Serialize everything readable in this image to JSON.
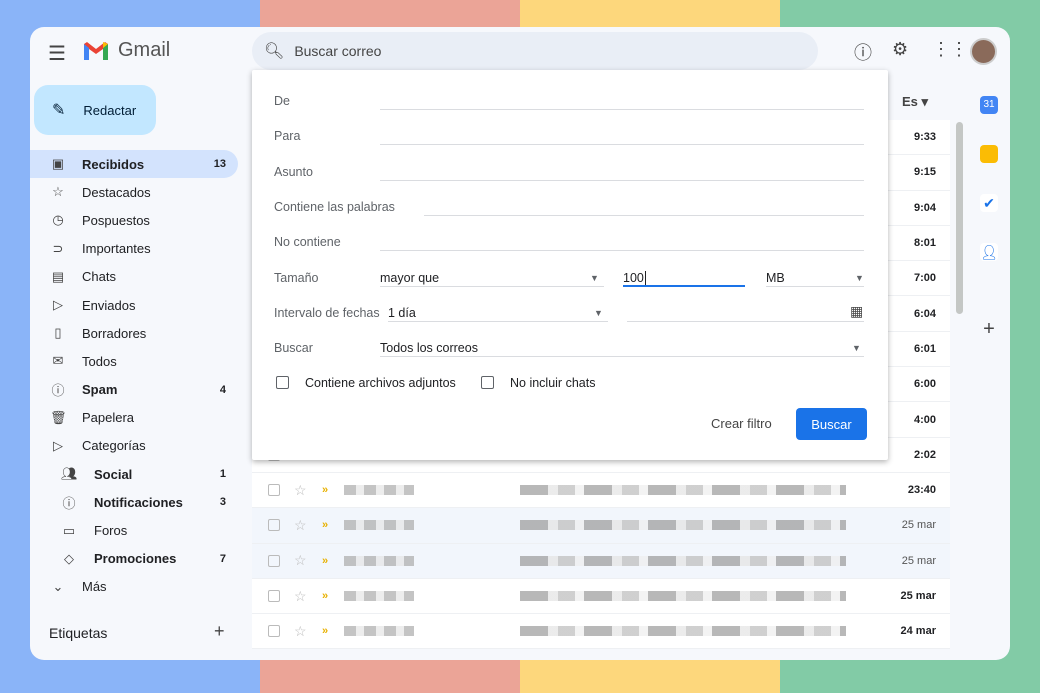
{
  "colors": {
    "stripes": [
      "#8ab4f8",
      "#eba497",
      "#fdd77c",
      "#82cba6"
    ],
    "accent": "#1a73e8",
    "selected": "#d3e3fd",
    "compose": "#c2e7ff"
  },
  "header": {
    "app_name": "Gmail",
    "search_placeholder": "Buscar correo"
  },
  "compose_label": "Redactar",
  "nav": [
    {
      "icon": "inbox-icon",
      "label": "Recibidos",
      "count": "13",
      "bold": true,
      "active": true
    },
    {
      "icon": "star-icon",
      "label": "Destacados"
    },
    {
      "icon": "clock-icon",
      "label": "Pospuestos"
    },
    {
      "icon": "important-icon",
      "label": "Importantes"
    },
    {
      "icon": "chat-icon",
      "label": "Chats"
    },
    {
      "icon": "send-icon",
      "label": "Enviados"
    },
    {
      "icon": "draft-icon",
      "label": "Borradores"
    },
    {
      "icon": "all-mail-icon",
      "label": "Todos"
    },
    {
      "icon": "spam-icon",
      "label": "Spam",
      "count": "4",
      "bold": true
    },
    {
      "icon": "trash-icon",
      "label": "Papelera"
    },
    {
      "icon": "label-icon",
      "label": "Categorías"
    },
    {
      "icon": "people-icon",
      "label": "Social",
      "count": "1",
      "bold": true,
      "sub": true
    },
    {
      "icon": "info-icon",
      "label": "Notificaciones",
      "count": "3",
      "bold": true,
      "sub": true
    },
    {
      "icon": "forum-icon",
      "label": "Foros",
      "sub": true
    },
    {
      "icon": "tag-icon",
      "label": "Promociones",
      "count": "7",
      "bold": true,
      "sub": true
    },
    {
      "icon": "chevron-down-icon",
      "label": "Más"
    }
  ],
  "labels_heading": "Etiquetas",
  "list_header": "Es",
  "emails": [
    {
      "time": "9:33"
    },
    {
      "time": "9:15"
    },
    {
      "time": "9:04"
    },
    {
      "time": "8:01"
    },
    {
      "time": "7:00"
    },
    {
      "time": "6:04"
    },
    {
      "time": "6:01"
    },
    {
      "time": "6:00"
    },
    {
      "time": "4:00"
    },
    {
      "time": "2:02"
    },
    {
      "time": "23:40"
    },
    {
      "time": "25 mar",
      "read": true
    },
    {
      "time": "25 mar",
      "read": true
    },
    {
      "time": "25 mar"
    },
    {
      "time": "24 mar"
    }
  ],
  "search_panel": {
    "from_label": "De",
    "to_label": "Para",
    "subject_label": "Asunto",
    "has_words_label": "Contiene las palabras",
    "not_contains_label": "No contiene",
    "size_label": "Tamaño",
    "size_operator": "mayor que",
    "size_value": "100",
    "size_unit": "MB",
    "date_label": "Intervalo de fechas",
    "date_range": "1 día",
    "search_in_label": "Buscar",
    "search_in_value": "Todos los correos",
    "attachments_label": "Contiene archivos adjuntos",
    "exclude_chats_label": "No incluir chats",
    "create_filter": "Crear filtro",
    "search_button": "Buscar"
  }
}
